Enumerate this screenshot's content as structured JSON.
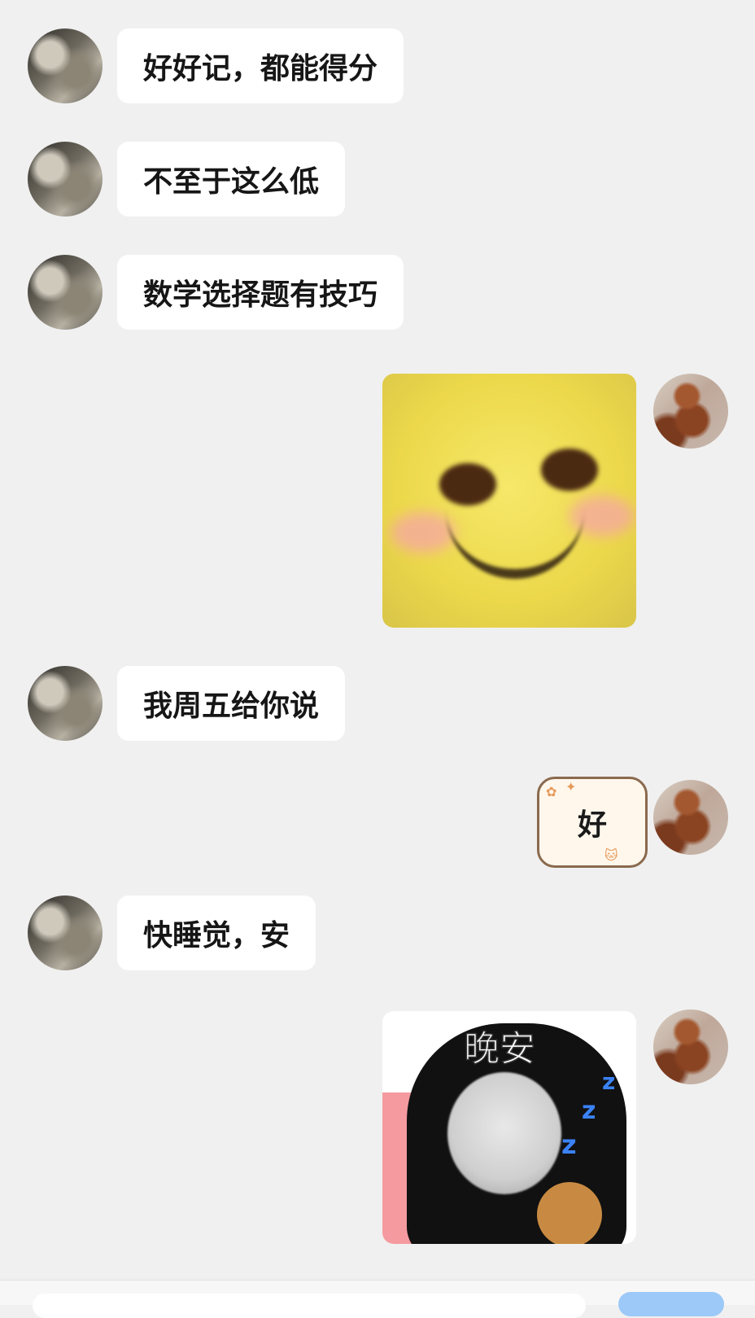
{
  "messages": [
    {
      "side": "left",
      "type": "text",
      "text": "好好记，都能得分"
    },
    {
      "side": "left",
      "type": "text",
      "text": "不至于这么低"
    },
    {
      "side": "left",
      "type": "text",
      "text": "数学选择题有技巧"
    },
    {
      "side": "right",
      "type": "sticker",
      "sticker": "blushing-smile-emoji"
    },
    {
      "side": "left",
      "type": "text",
      "text": "我周五给你说"
    },
    {
      "side": "right",
      "type": "sticker",
      "sticker": "cat-note",
      "text": "好"
    },
    {
      "side": "left",
      "type": "text",
      "text": "快睡觉，安"
    },
    {
      "side": "right",
      "type": "sticker",
      "sticker": "panda-goodnight",
      "text": "晚安"
    }
  ],
  "colors": {
    "background": "#f0f0f0",
    "bubble": "#ffffff",
    "send_button": "#9cc9f7"
  }
}
